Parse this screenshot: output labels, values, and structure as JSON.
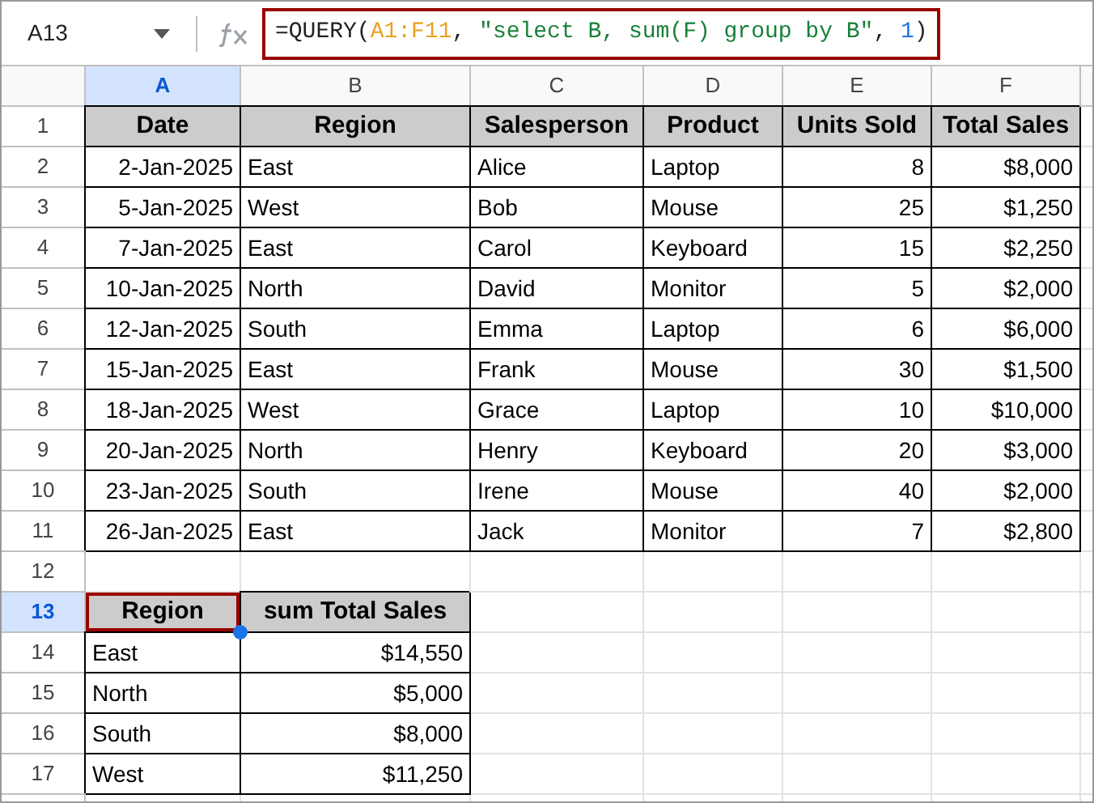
{
  "name_box": "A13",
  "formula": [
    {
      "kind": "plain",
      "text": "=QUERY("
    },
    {
      "kind": "range",
      "text": "A1:F11"
    },
    {
      "kind": "plain",
      "text": ", "
    },
    {
      "kind": "string",
      "text": "\"select B, sum(F) group by B\""
    },
    {
      "kind": "plain",
      "text": ", "
    },
    {
      "kind": "number",
      "text": "1"
    },
    {
      "kind": "plain",
      "text": ")"
    }
  ],
  "columns": [
    {
      "label": "A",
      "selected": true
    },
    {
      "label": "B",
      "selected": false
    },
    {
      "label": "C",
      "selected": false
    },
    {
      "label": "D",
      "selected": false
    },
    {
      "label": "E",
      "selected": false
    },
    {
      "label": "F",
      "selected": false
    }
  ],
  "rows": [
    {
      "number": "1",
      "kind": "header",
      "selected": false,
      "cells": [
        "Date",
        "Region",
        "Salesperson",
        "Product",
        "Units Sold",
        "Total Sales"
      ]
    },
    {
      "number": "2",
      "kind": "data",
      "selected": false,
      "cells": [
        "2-Jan-2025",
        "East",
        "Alice",
        "Laptop",
        "8",
        "$8,000"
      ]
    },
    {
      "number": "3",
      "kind": "data",
      "selected": false,
      "cells": [
        "5-Jan-2025",
        "West",
        "Bob",
        "Mouse",
        "25",
        "$1,250"
      ]
    },
    {
      "number": "4",
      "kind": "data",
      "selected": false,
      "cells": [
        "7-Jan-2025",
        "East",
        "Carol",
        "Keyboard",
        "15",
        "$2,250"
      ]
    },
    {
      "number": "5",
      "kind": "data",
      "selected": false,
      "cells": [
        "10-Jan-2025",
        "North",
        "David",
        "Monitor",
        "5",
        "$2,000"
      ]
    },
    {
      "number": "6",
      "kind": "data",
      "selected": false,
      "cells": [
        "12-Jan-2025",
        "South",
        "Emma",
        "Laptop",
        "6",
        "$6,000"
      ]
    },
    {
      "number": "7",
      "kind": "data",
      "selected": false,
      "cells": [
        "15-Jan-2025",
        "East",
        "Frank",
        "Mouse",
        "30",
        "$1,500"
      ]
    },
    {
      "number": "8",
      "kind": "data",
      "selected": false,
      "cells": [
        "18-Jan-2025",
        "West",
        "Grace",
        "Laptop",
        "10",
        "$10,000"
      ]
    },
    {
      "number": "9",
      "kind": "data",
      "selected": false,
      "cells": [
        "20-Jan-2025",
        "North",
        "Henry",
        "Keyboard",
        "20",
        "$3,000"
      ]
    },
    {
      "number": "10",
      "kind": "data",
      "selected": false,
      "cells": [
        "23-Jan-2025",
        "South",
        "Irene",
        "Mouse",
        "40",
        "$2,000"
      ]
    },
    {
      "number": "11",
      "kind": "data",
      "selected": false,
      "cells": [
        "26-Jan-2025",
        "East",
        "Jack",
        "Monitor",
        "7",
        "$2,800"
      ]
    },
    {
      "number": "12",
      "kind": "blank",
      "selected": false,
      "cells": []
    },
    {
      "number": "13",
      "kind": "summary_header",
      "selected": true,
      "cells": [
        "Region",
        "sum Total Sales"
      ]
    },
    {
      "number": "14",
      "kind": "summary",
      "selected": false,
      "cells": [
        "East",
        "$14,550"
      ]
    },
    {
      "number": "15",
      "kind": "summary",
      "selected": false,
      "cells": [
        "North",
        "$5,000"
      ]
    },
    {
      "number": "16",
      "kind": "summary",
      "selected": false,
      "cells": [
        "South",
        "$8,000"
      ]
    },
    {
      "number": "17",
      "kind": "summary",
      "selected": false,
      "cells": [
        "West",
        "$11,250"
      ]
    }
  ]
}
